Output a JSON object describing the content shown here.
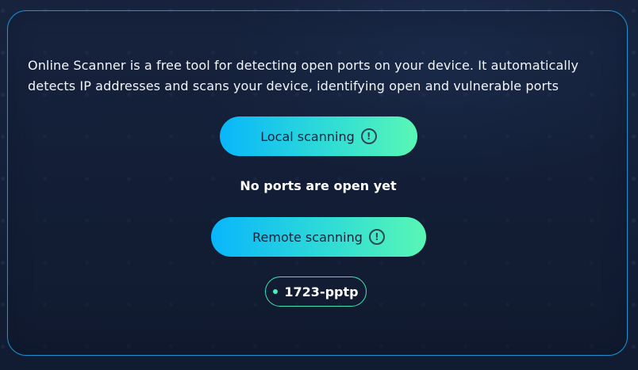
{
  "scanner": {
    "description": "Online Scanner is a free tool for detecting open ports on your device. It automatically detects IP addresses and scans your device, identifying open and vulnerable ports",
    "local_button_label": "Local scanning",
    "remote_button_label": "Remote scanning",
    "info_icon_glyph": "!",
    "status_text": "No ports are open yet",
    "open_ports": [
      {
        "label": "1723-pptp"
      }
    ]
  },
  "colors": {
    "background": "#13203a",
    "card_border": "#1f8fd0",
    "button_gradient_start": "#09b6fb",
    "button_gradient_end": "#59f7b4",
    "port_badge_border": "#3fe6b6",
    "port_dot": "#48f0b4"
  },
  "icons": {
    "info": "info-exclamation-icon",
    "status_dot": "green-dot-icon"
  }
}
